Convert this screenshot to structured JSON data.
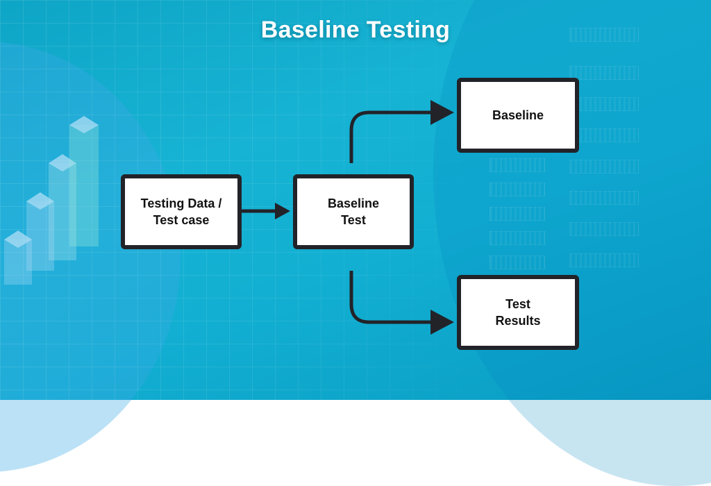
{
  "title": "Baseline Testing",
  "nodes": {
    "input": {
      "line1": "Testing Data /",
      "line2": "Test case"
    },
    "process": {
      "line1": "Baseline",
      "line2": "Test"
    },
    "baseline": {
      "label": "Baseline"
    },
    "results": {
      "line1": "Test",
      "line2": "Results"
    }
  },
  "edges": [
    {
      "from": "input",
      "to": "process"
    },
    {
      "from": "process",
      "to": "baseline"
    },
    {
      "from": "process",
      "to": "results"
    }
  ],
  "colors": {
    "background": "#12afd2",
    "box_fill": "#ffffff",
    "box_border": "#222329",
    "arrow": "#222329",
    "title": "#ffffff"
  }
}
